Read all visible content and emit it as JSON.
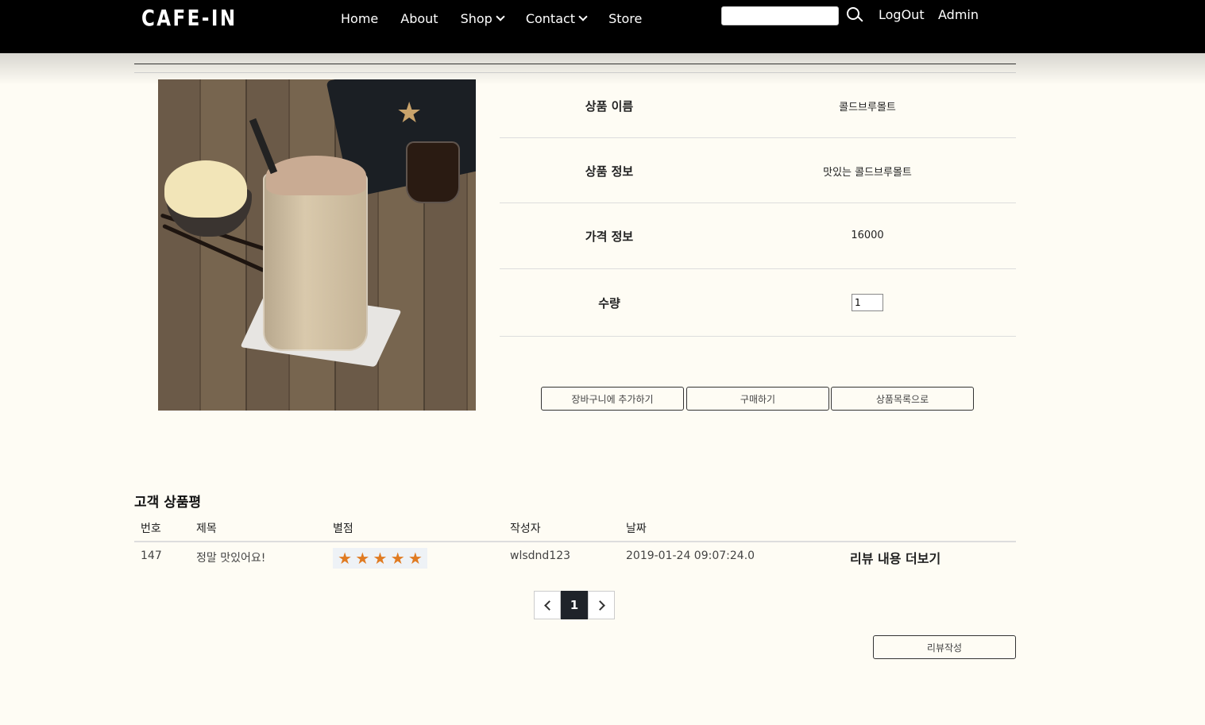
{
  "brand": "CAFE-IN",
  "nav": {
    "items": [
      {
        "label": "Home",
        "dropdown": false
      },
      {
        "label": "About",
        "dropdown": false
      },
      {
        "label": "Shop",
        "dropdown": true
      },
      {
        "label": "Contact",
        "dropdown": true
      },
      {
        "label": "Store",
        "dropdown": false
      }
    ],
    "search_value": "",
    "logout_label": "LogOut",
    "admin_label": "Admin"
  },
  "product": {
    "image_icon": "coffee-frappe-photo",
    "rows": [
      {
        "label": "상품 이름",
        "value": "콜드브루몰트"
      },
      {
        "label": "상품 정보",
        "value": "맛있는 콜드브루몰트"
      },
      {
        "label": "가격 정보",
        "value": "16000"
      },
      {
        "label": "수량",
        "value": "1"
      }
    ],
    "buttons": {
      "cart": "장바구니에 추가하기",
      "buy": "구매하기",
      "list": "상품목록으로"
    }
  },
  "reviews": {
    "title": "고객 상품평",
    "headers": [
      "번호",
      "제목",
      "별점",
      "작성자",
      "날짜"
    ],
    "rows": [
      {
        "no": "147",
        "title": "정말 맛있어요!",
        "stars": 5,
        "author": "wlsdnd123",
        "date": "2019-01-24 09:07:24.0",
        "more": "리뷰 내용 더보기"
      }
    ],
    "pagination": {
      "current": "1",
      "pages": [
        "1"
      ]
    },
    "write_label": "리뷰작성"
  },
  "colors": {
    "header_bg": "#000000",
    "page_bg": "#fefcf4",
    "star": "#e07b22",
    "pager_active": "#1f2329"
  }
}
